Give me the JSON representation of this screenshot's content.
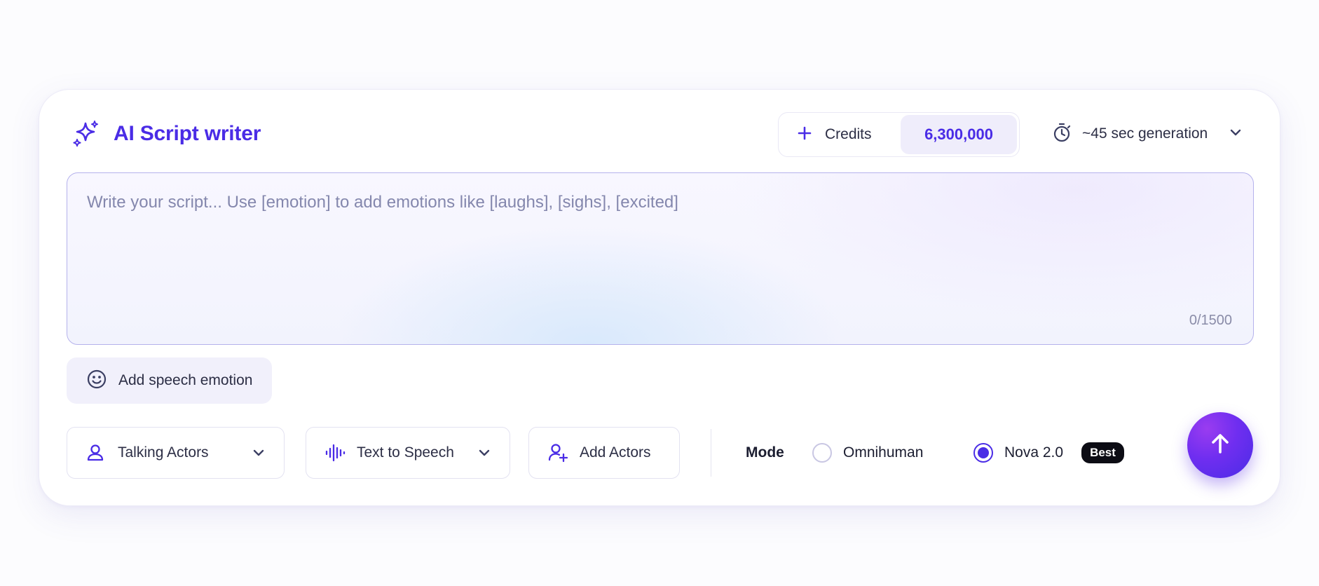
{
  "header": {
    "title": "AI Script writer",
    "title_icon": "sparkles-icon",
    "credits_label": "Credits",
    "credits_value": "6,300,000",
    "generation_label": "~45 sec generation"
  },
  "script": {
    "placeholder": "Write your script... Use [emotion] to add emotions like [laughs], [sighs], [excited]",
    "value": "",
    "counter": "0/1500"
  },
  "emotion_button": {
    "label": "Add speech emotion",
    "icon": "smiley-icon"
  },
  "toolbar": {
    "talking_actors": "Talking Actors",
    "text_to_speech": "Text to Speech",
    "add_actors": "Add Actors"
  },
  "mode": {
    "label": "Mode",
    "options": [
      {
        "label": "Omnihuman",
        "selected": false
      },
      {
        "label": "Nova 2.0",
        "selected": true,
        "badge": "Best"
      }
    ]
  },
  "colors": {
    "accent": "#4a2ce6",
    "submit_gradient_start": "#9a3cf0",
    "submit_gradient_end": "#4a2ce6",
    "badge_bg": "#0c0c14"
  }
}
